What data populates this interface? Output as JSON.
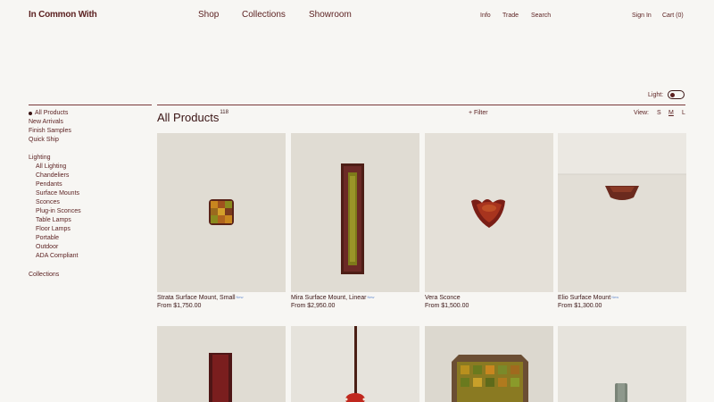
{
  "header": {
    "brand": "In Common With",
    "main_nav": [
      "Shop",
      "Collections",
      "Showroom"
    ],
    "secondary_nav": [
      "Info",
      "Trade",
      "Search"
    ],
    "sign_in": "Sign In",
    "cart": "Cart (0)"
  },
  "light_toggle": {
    "label": "Light:",
    "state": "on"
  },
  "sidebar": {
    "group1": [
      "All Products",
      "New Arrivals",
      "Finish Samples",
      "Quick Ship"
    ],
    "lighting_heading": "Lighting",
    "lighting_items": [
      "All Lighting",
      "Chandeliers",
      "Pendants",
      "Surface Mounts",
      "Sconces",
      "Plug-in Sconces",
      "Table Lamps",
      "Floor Lamps",
      "Portable",
      "Outdoor",
      "ADA Compliant"
    ],
    "collections": "Collections",
    "active_item": "All Products"
  },
  "listing": {
    "title": "All Products",
    "count": "118",
    "filter_label": "+ Filter",
    "view_label": "View:",
    "view_options": [
      "S",
      "M",
      "L"
    ],
    "active_view": "M"
  },
  "products": [
    {
      "name": "Strata Surface Mount, Small",
      "badge": "New",
      "price": "From $1,750.00"
    },
    {
      "name": "Mira Surface Mount, Linear",
      "badge": "New",
      "price": "From $2,950.00"
    },
    {
      "name": "Vera Sconce",
      "badge": "",
      "price": "From $1,500.00"
    },
    {
      "name": "Elio Surface Mount",
      "badge": "New",
      "price": "From $1,300.00"
    }
  ],
  "colors": {
    "background": "#f7f6f3",
    "text": "#5a1f1f",
    "product_bg": "#e0dcd3",
    "oxblood": "#6b2a26",
    "chartreuse": "#8a8a1e",
    "ochre": "#c8861f"
  }
}
